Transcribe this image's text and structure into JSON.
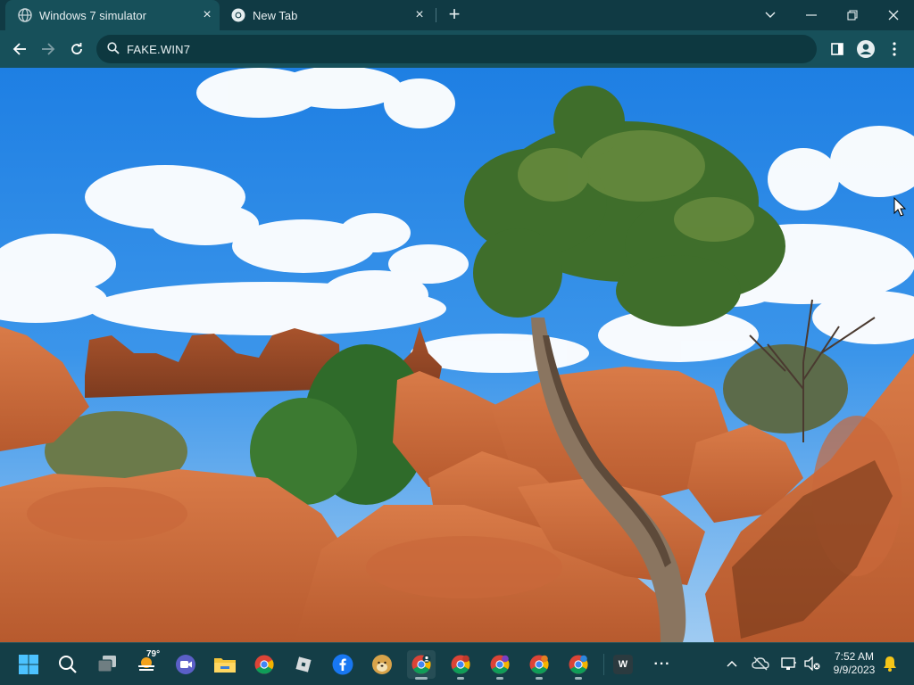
{
  "browser": {
    "tabs": [
      {
        "title": "Windows 7 simulator",
        "active": true,
        "icon": "globe-icon"
      },
      {
        "title": "New Tab",
        "active": false,
        "icon": "chrome-icon"
      }
    ],
    "address": "FAKE.WIN7",
    "colors": {
      "tabstrip": "#103a44",
      "toolbar": "#17505a",
      "omnibox": "#0d3840"
    }
  },
  "taskbar": {
    "weather_temp": "79°",
    "clock_time": "7:52 AM",
    "clock_date": "9/9/2023",
    "word_letter": "W",
    "more_glyph": "···",
    "pinned": [
      "start-windows-icon",
      "search-icon",
      "task-view-icon",
      "weather-widget-icon",
      "teams-meet-icon",
      "file-explorer-icon",
      "chrome-icon",
      "roblox-icon",
      "facebook-icon",
      "doge-icon",
      "chrome-profile-icon",
      "chrome-profile-icon",
      "chrome-profile-icon",
      "chrome-profile-icon",
      "chrome-profile-icon",
      "word-icon",
      "more-icon"
    ],
    "colors": {
      "bar": "#143e47",
      "bell": "#f5c518"
    }
  }
}
